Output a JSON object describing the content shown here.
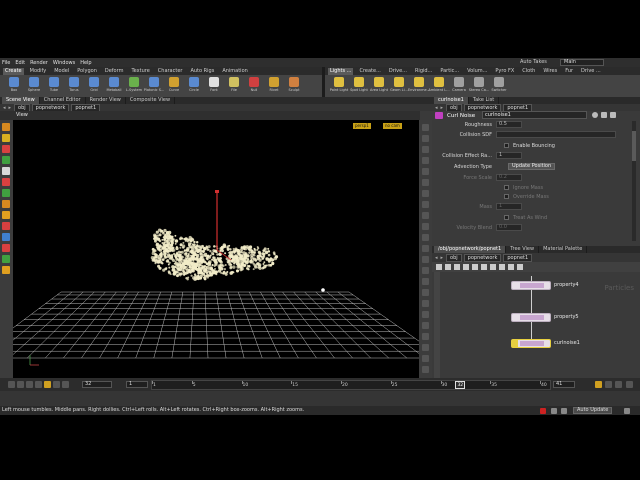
{
  "menubar": {
    "menus": [
      "File",
      "Edit",
      "Render",
      "Windows",
      "Help"
    ],
    "takes_label": "Auto Takes",
    "desktop_value": "Main"
  },
  "shelf_left": {
    "tabs": [
      "Create",
      "Modify",
      "Model",
      "Polygon",
      "Deform",
      "Texture",
      "Character",
      "Auto Rigs",
      "Animation"
    ],
    "tools": [
      {
        "label": "Box",
        "color": "#5a8ad0"
      },
      {
        "label": "Sphere",
        "color": "#5a8ad0"
      },
      {
        "label": "Tube",
        "color": "#5a8ad0"
      },
      {
        "label": "Torus",
        "color": "#5a8ad0"
      },
      {
        "label": "Grid",
        "color": "#5a8ad0"
      },
      {
        "label": "Metaball",
        "color": "#5a8ad0"
      },
      {
        "label": "L-System",
        "color": "#6ab04c"
      },
      {
        "label": "Platonic S...",
        "color": "#5a8ad0"
      },
      {
        "label": "Curve",
        "color": "#d0a030"
      },
      {
        "label": "Circle",
        "color": "#5a8ad0"
      },
      {
        "label": "Font",
        "color": "#e0e0e0"
      },
      {
        "label": "File",
        "color": "#d0c060"
      },
      {
        "label": "Null",
        "color": "#d04040"
      },
      {
        "label": "Rivet",
        "color": "#d0a030"
      },
      {
        "label": "Sculpt",
        "color": "#d08040"
      }
    ]
  },
  "shelf_right": {
    "tabs": [
      "Lights ...",
      "Create...",
      "Drive...",
      "Rigid...",
      "Partic...",
      "Volum...",
      "Pyro FX",
      "Cloth",
      "Wires",
      "Fur",
      "Drive ..."
    ],
    "tools": [
      {
        "label": "Point Light",
        "color": "#e0c040"
      },
      {
        "label": "Spot Light",
        "color": "#e0c040"
      },
      {
        "label": "Area Light",
        "color": "#e0c040"
      },
      {
        "label": "Geom Li...",
        "color": "#e0c040"
      },
      {
        "label": "Environme...",
        "color": "#e0c040"
      },
      {
        "label": "Ambient L...",
        "color": "#e0c040"
      },
      {
        "label": "Camera",
        "color": "#a0a0a0"
      },
      {
        "label": "Stereo Ca...",
        "color": "#a0a0a0"
      },
      {
        "label": "Switcher",
        "color": "#a0a0a0"
      }
    ]
  },
  "left_pane": {
    "tabs": [
      "Scene View",
      "Channel Editor",
      "Render View",
      "Composite View"
    ],
    "path": [
      "obj",
      "popnetwork",
      "popnet1"
    ],
    "view_title": "View",
    "camera_buttons": [
      "persp1",
      "no cam"
    ]
  },
  "param_pane": {
    "tabs": [
      "curlnoise1",
      "Take List"
    ],
    "path": [
      "obj",
      "popnetwork",
      "popnet1"
    ],
    "node_type": "Curl Noise",
    "node_name": "curlnoise1",
    "rows": [
      {
        "label": "Roughness",
        "value": "0.5",
        "dim": false
      },
      {
        "label": "Collision SDF",
        "value": "",
        "dim": false
      },
      {
        "label": "",
        "value": "Enable Bouncing",
        "dim": false
      },
      {
        "label": "Collision Effect Ra...",
        "value": "1",
        "dim": false
      },
      {
        "label": "Advection Type",
        "value": "Update Position",
        "dim": false
      },
      {
        "label": "Force Scale",
        "value": "0.2",
        "dim": true
      },
      {
        "label": "",
        "value": "Ignore Mass",
        "dim": true
      },
      {
        "label": "",
        "value": "Override Mass",
        "dim": true
      },
      {
        "label": "Mass",
        "value": "1",
        "dim": true
      },
      {
        "label": "",
        "value": "Treat As Wind",
        "dim": true
      },
      {
        "label": "Velocity Blend",
        "value": "0.0",
        "dim": true
      }
    ]
  },
  "network_pane": {
    "tabs": [
      "/obj/popnetwork/popnet1",
      "Tree View",
      "Material Palette"
    ],
    "path": [
      "obj",
      "popnetwork",
      "popnet1"
    ],
    "context_label": "Particles",
    "nodes": [
      "property4",
      "property5",
      "curlnoise1"
    ]
  },
  "timeline": {
    "frame": "32",
    "start": "1",
    "end": "41",
    "ticks": [
      "1",
      "5",
      "10",
      "15",
      "20",
      "25",
      "30",
      "32",
      "35",
      "40"
    ],
    "range_start": 1,
    "range_end": 41,
    "current": 32
  },
  "status_bar": {
    "message": "Left mouse tumbles. Middle pans. Right dollies. Ctrl+Left rolls. Alt+Left rotates. Ctrl+Right box-zooms. Alt+Right zooms.",
    "auto_update_label": "Auto Update"
  },
  "colors": {
    "accent_yellow": "#c8a016",
    "particle_color": "#f2ecc8",
    "node_flag": "#e8d040",
    "background": "#3a3a3a"
  }
}
